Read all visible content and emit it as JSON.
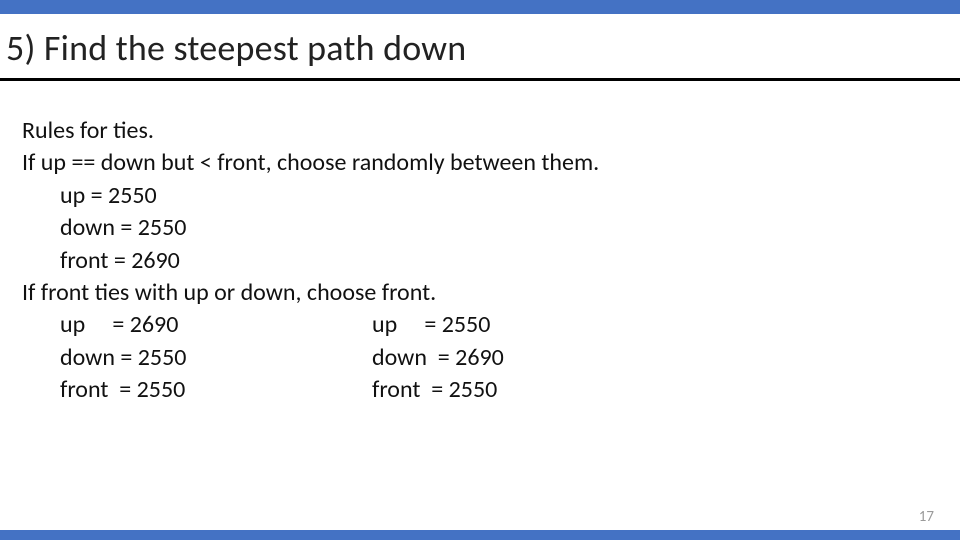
{
  "title": "5) Find the steepest path down",
  "content": {
    "intro": "Rules for ties.",
    "rule1": "If up == down but < front, choose randomly between them.",
    "block1": {
      "up": "up = 2550",
      "down": "down = 2550",
      "front": "front = 2690"
    },
    "rule2": "If front ties with up or down, choose front.",
    "colA": {
      "up": "up     = 2690",
      "down": "down = 2550",
      "front": "front  = 2550"
    },
    "colB": {
      "up": "up     = 2550",
      "down": "down  = 2690",
      "front": "front  = 2550"
    }
  },
  "page_number": "17"
}
